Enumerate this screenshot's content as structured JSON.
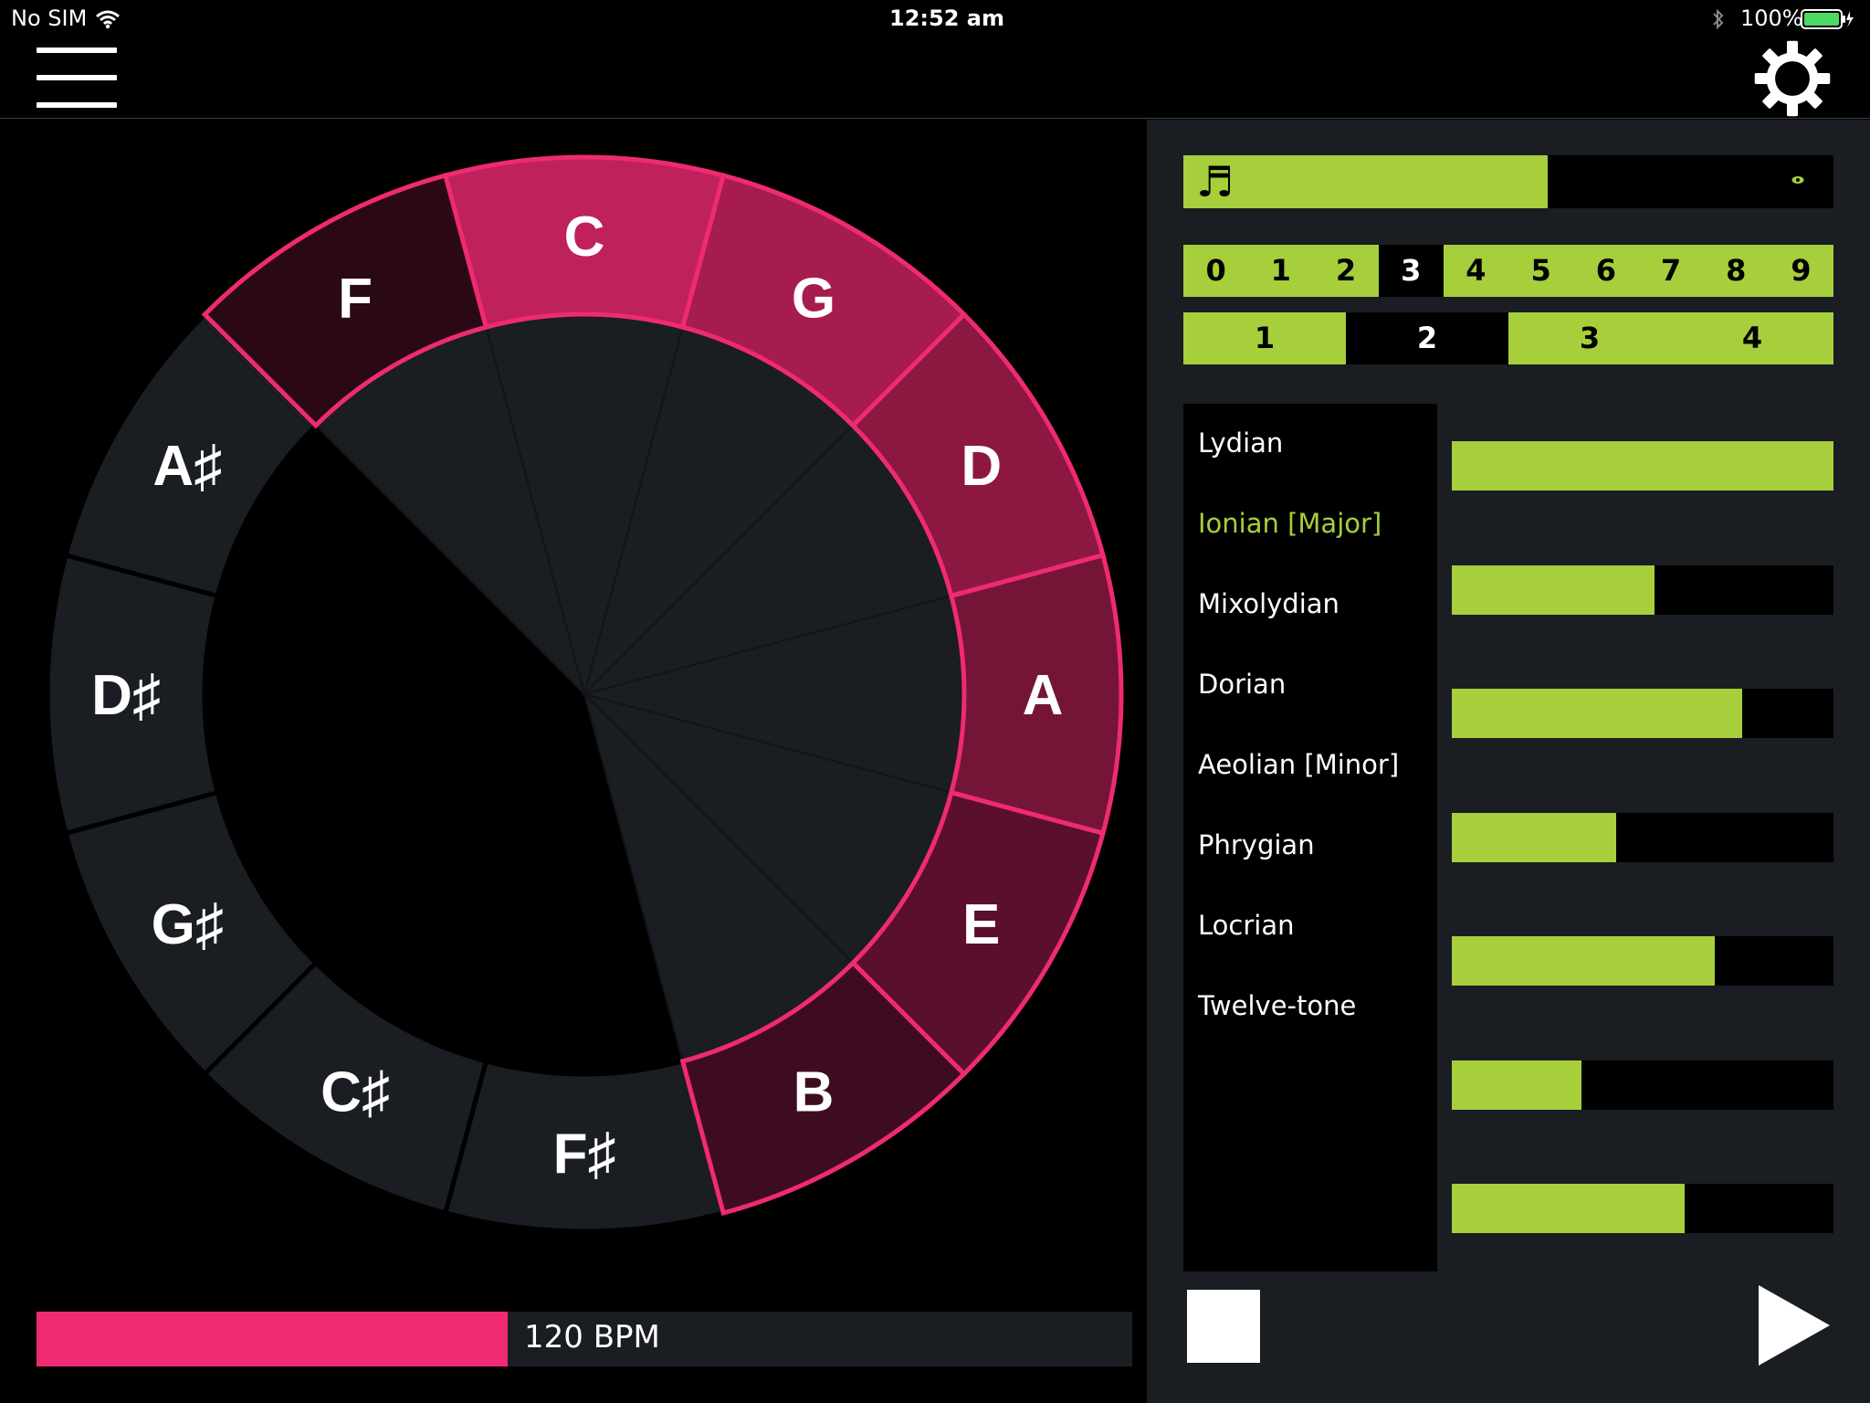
{
  "status_bar": {
    "carrier": "No SIM",
    "time": "12:52 am",
    "battery": "100%"
  },
  "nav": {
    "menu_icon": "hamburger-icon",
    "settings_icon": "gear-icon"
  },
  "colors": {
    "accent_pink": "#ef2a73",
    "accent_green": "#a6cf3b",
    "panel": "#1a1d21",
    "inactive_key": "#1a1d21"
  },
  "wheel": {
    "keys": [
      {
        "label": "C",
        "active": true,
        "color": "#bf215c"
      },
      {
        "label": "G",
        "active": true,
        "color": "#a61c4f"
      },
      {
        "label": "D",
        "active": true,
        "color": "#8c1842"
      },
      {
        "label": "A",
        "active": true,
        "color": "#741538"
      },
      {
        "label": "E",
        "active": true,
        "color": "#5a0f2c"
      },
      {
        "label": "B",
        "active": true,
        "color": "#3e0c20"
      },
      {
        "label": "F♯",
        "active": false,
        "color": "#1a1d21"
      },
      {
        "label": "C♯",
        "active": false,
        "color": "#1a1d21"
      },
      {
        "label": "G♯",
        "active": false,
        "color": "#1a1d21"
      },
      {
        "label": "D♯",
        "active": false,
        "color": "#1a1d21"
      },
      {
        "label": "A♯",
        "active": false,
        "color": "#1a1d21"
      },
      {
        "label": "F",
        "active": true,
        "color": "#2a0914"
      }
    ]
  },
  "tempo": {
    "label": "120 BPM",
    "fraction": 0.43
  },
  "sequence": {
    "fill_fraction": 0.56,
    "note_icon": "sixteenth-note-icon",
    "playhead_icon": "eye-icon"
  },
  "octave_digits": {
    "items": [
      "0",
      "1",
      "2",
      "3",
      "4",
      "5",
      "6",
      "7",
      "8",
      "9"
    ],
    "selected": 3
  },
  "beat_selector": {
    "items": [
      "1",
      "2",
      "3",
      "4"
    ],
    "selected": 1
  },
  "modes": {
    "items": [
      {
        "label": "Lydian",
        "active": false
      },
      {
        "label": "Ionian [Major]",
        "active": true
      },
      {
        "label": "Mixolydian",
        "active": false
      },
      {
        "label": "Dorian",
        "active": false
      },
      {
        "label": "Aeolian [Minor]",
        "active": false
      },
      {
        "label": "Phrygian",
        "active": false
      },
      {
        "label": "Locrian",
        "active": false
      },
      {
        "label": "Twelve-tone",
        "active": false
      }
    ]
  },
  "level_bars": {
    "values": [
      1.0,
      0.53,
      0.76,
      0.43,
      0.69,
      0.34,
      0.61
    ]
  },
  "transport": {
    "stop_icon": "stop-icon",
    "play_icon": "play-icon"
  }
}
